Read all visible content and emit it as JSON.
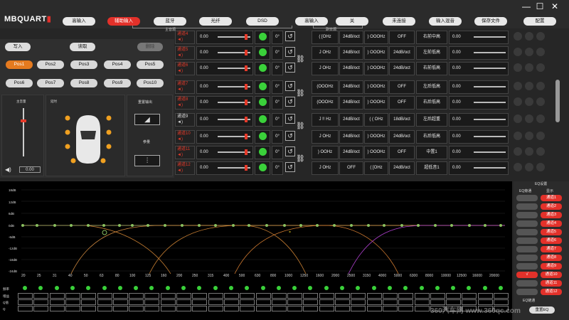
{
  "app": {
    "logo_text": "MBQUART",
    "window_controls": [
      "—",
      "☐",
      "✕"
    ]
  },
  "top_buttons": [
    {
      "label": "高输入",
      "active": false
    },
    {
      "label": "辅助输入",
      "active": true
    },
    {
      "label": "蓝牙",
      "active": false
    },
    {
      "label": "光纤",
      "active": false
    },
    {
      "label": "DSD",
      "active": false
    },
    {
      "label": "高输入",
      "active": false
    },
    {
      "label": "关",
      "active": false
    },
    {
      "label": "未连接",
      "active": false
    },
    {
      "label": "输入混音",
      "active": false
    },
    {
      "label": "保存文件",
      "active": false
    },
    {
      "label": "配置",
      "active": false
    }
  ],
  "group_labels": {
    "main": "主音源",
    "sub": "副音源"
  },
  "left": {
    "write": "写入",
    "read": "读取",
    "delete": "删除",
    "positions": [
      "Pos1",
      "Pos2",
      "Pos3",
      "Pos4",
      "Pos5",
      "Pos6",
      "Pos7",
      "Pos8",
      "Pos9",
      "Pos10"
    ],
    "master_label": "主音量",
    "delay_label": "延时",
    "heavy_label": "重置输出",
    "param_label": "参量",
    "volume_value": "0.00"
  },
  "channels": [
    {
      "name": "通道4",
      "sub": "◄)",
      "delay": "0.00",
      "phase": "0°",
      "freq1": "( [OHz",
      "slope": "24dB/oct",
      "freq2": ") OOOHz",
      "slope2": "OFF",
      "output": "右前中高",
      "value": "0.00"
    },
    {
      "name": "通道5",
      "sub": "◄)",
      "delay": "0.00",
      "phase": "0°",
      "freq1": "J OHz",
      "slope": "24dB/oct",
      "freq2": ") OOOHz",
      "slope2": "24dB/oct",
      "output": "左前低高",
      "value": "0.00"
    },
    {
      "name": "通道6",
      "sub": "◄)",
      "delay": "0.00",
      "phase": "0°",
      "freq1": "J OHz",
      "slope": "24dB/oct",
      "freq2": ") OOOHz",
      "slope2": "24dB/oct",
      "output": "右前低高",
      "value": "0.00"
    },
    {
      "name": "通道7",
      "sub": "◄)",
      "delay": "0.00",
      "phase": "0°",
      "freq1": "(OOOHz",
      "slope": "24dB/oct",
      "freq2": ") OOOHz",
      "slope2": "OFF",
      "output": "左后低高",
      "value": "0.00"
    },
    {
      "name": "通道8",
      "sub": "◄)",
      "delay": "0.00",
      "phase": "0°",
      "freq1": "(OOOHz",
      "slope": "24dB/oct",
      "freq2": ") OOOHz",
      "slope2": "OFF",
      "output": "右后低高",
      "value": "0.00"
    },
    {
      "name": "通道9",
      "sub": "◄)",
      "delay": "0.00",
      "phase": "0°",
      "freq1": "J !! Hz",
      "slope": "24dB/oct",
      "freq2": "( ( OHz",
      "slope2": "18dB/oct",
      "output": "左后超重",
      "value": "0.00"
    },
    {
      "name": "通道10",
      "sub": "◄)",
      "delay": "0.00",
      "phase": "0°",
      "freq1": "J OHz",
      "slope": "24dB/oct",
      "freq2": ") OOOHz",
      "slope2": "24dB/oct",
      "output": "右后低高",
      "value": "0.00"
    },
    {
      "name": "通道11",
      "sub": "◄)",
      "delay": "0.00",
      "phase": "0°",
      "freq1": ") OOHz",
      "slope": "24dB/oct",
      "freq2": ") OOOHz",
      "slope2": "OFF",
      "output": "中置1",
      "value": "0.00"
    },
    {
      "name": "通道12",
      "sub": "◄)",
      "delay": "0.00",
      "phase": "0°",
      "freq1": "J OHz",
      "slope": "OFF",
      "freq2": "( [OHz",
      "slope2": "24dB/oct",
      "output": "超低音1",
      "value": "0.00"
    }
  ],
  "eq": {
    "y_labels": [
      "18dB",
      "12dB",
      "6dB",
      "0dB",
      "-6dB",
      "-12dB",
      "-18dB",
      "-24dB",
      "-30dB",
      "-36dB",
      "-40dB"
    ],
    "x_labels": [
      "20",
      "25",
      "31",
      "40",
      "50",
      "63",
      "80",
      "100",
      "125",
      "160",
      "200",
      "250",
      "315",
      "400",
      "500",
      "630",
      "800",
      "1000",
      "1250",
      "1600",
      "2000",
      "2500",
      "3150",
      "4000",
      "5000",
      "6300",
      "8000",
      "10000",
      "12500",
      "16000",
      "20000"
    ],
    "row_labels": [
      "频率",
      "增益",
      "Q值",
      "Q"
    ]
  },
  "right": {
    "eq_title": "EQ设置",
    "eq_sub": "EQ旁通",
    "show_label": "显示",
    "channels": [
      "通道1",
      "通道2",
      "通道3",
      "通道4",
      "通道5",
      "通道6",
      "通道7",
      "通道8",
      "通道9",
      "通道10",
      "通道11",
      "通道12"
    ],
    "check": "√",
    "eq_link": "EQ链通",
    "reset": "重置EQ"
  },
  "watermark": "360汽车网 www.360qc.com"
}
